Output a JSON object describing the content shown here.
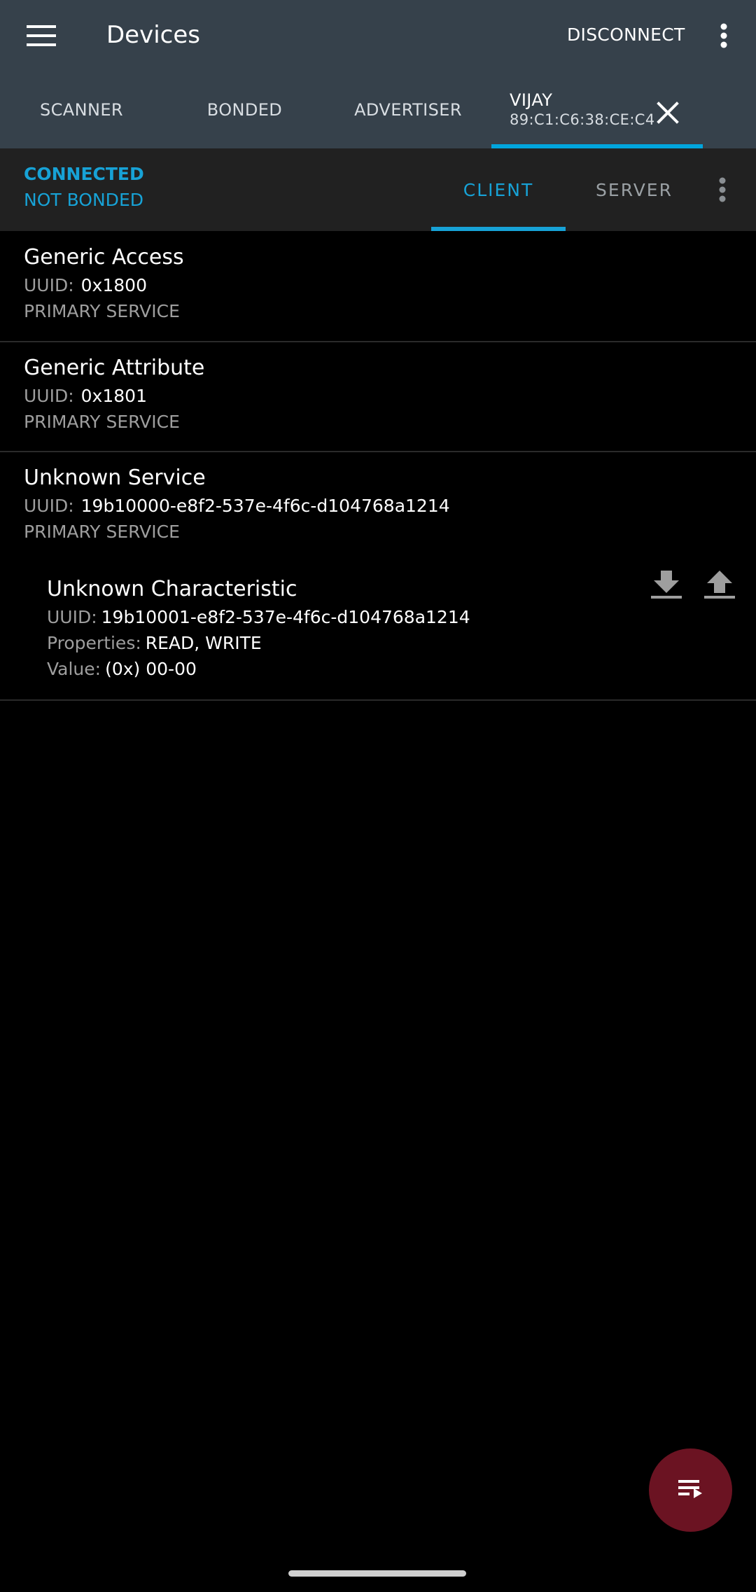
{
  "toolbar": {
    "title": "Devices",
    "disconnect_label": "DISCONNECT",
    "menu_icon": "hamburger-menu-icon",
    "overflow_icon": "more-vert-icon"
  },
  "tabs": {
    "scanner": "SCANNER",
    "bonded": "BONDED",
    "advertiser": "ADVERTISER",
    "device": {
      "name": "VIJAY",
      "address": "89:C1:C6:38:CE:C4",
      "close_icon": "close-icon"
    },
    "accent_color": "#00a5dd"
  },
  "connection": {
    "state": "CONNECTED",
    "bond_state": "NOT BONDED",
    "client_tab": "CLIENT",
    "server_tab": "SERVER",
    "color": "#17a2d6"
  },
  "services": [
    {
      "name": "Generic Access",
      "uuid_label": "UUID:",
      "uuid": "0x1800",
      "type": "PRIMARY SERVICE"
    },
    {
      "name": "Generic Attribute",
      "uuid_label": "UUID:",
      "uuid": "0x1801",
      "type": "PRIMARY SERVICE"
    },
    {
      "name": "Unknown Service",
      "uuid_label": "UUID:",
      "uuid": "19b10000-e8f2-537e-4f6c-d104768a1214",
      "type": "PRIMARY SERVICE",
      "characteristic": {
        "name": "Unknown Characteristic",
        "uuid_label": "UUID:",
        "uuid": "19b10001-e8f2-537e-4f6c-d104768a1214",
        "properties_label": "Properties:",
        "properties": "READ, WRITE",
        "value_label": "Value:",
        "value": "(0x) 00-00",
        "read_icon": "download-icon",
        "write_icon": "upload-icon"
      }
    }
  ],
  "fab": {
    "icon": "playlist-play-icon",
    "color": "#6b1322"
  }
}
